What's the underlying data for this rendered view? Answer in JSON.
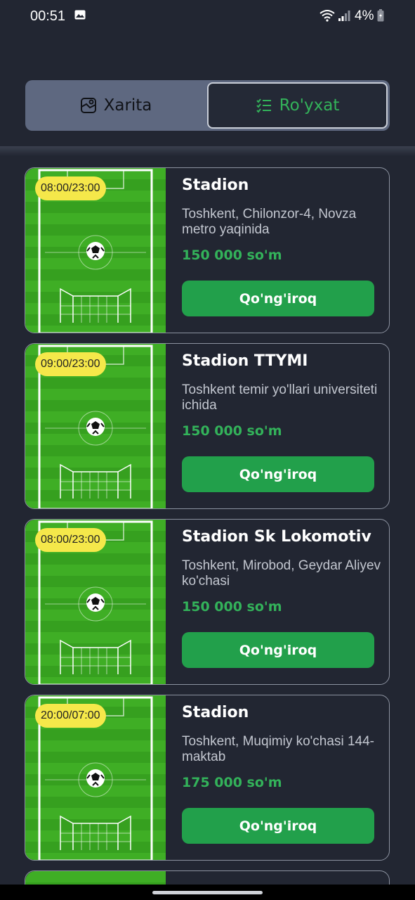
{
  "status_bar": {
    "time": "00:51",
    "battery": "4%",
    "icons": [
      "gallery-icon",
      "wifi-icon",
      "signal-icon",
      "battery-icon"
    ]
  },
  "segmented_control": {
    "map_label": "Xarita",
    "list_label": "Ro'yxat",
    "selected": "list",
    "accent_color": "#33b25a"
  },
  "stadiums": [
    {
      "hours": "08:00/23:00",
      "name": "Stadion",
      "address": "Toshkent, Chilonzor-4, Novza metro yaqinida",
      "price": "150 000 so'm",
      "call_label": "Qo'ng'iroq"
    },
    {
      "hours": "09:00/23:00",
      "name": "Stadion TTYMI",
      "address": "Toshkent temir yo'llari universiteti ichida",
      "price": "150 000 so'm",
      "call_label": "Qo'ng'iroq"
    },
    {
      "hours": "08:00/23:00",
      "name": "Stadion Sk Lokomotiv",
      "address": "Toshkent, Mirobod, Geydar Aliyev ko'chasi",
      "price": "150 000 so'm",
      "call_label": "Qo'ng'iroq"
    },
    {
      "hours": "20:00/07:00",
      "name": "Stadion",
      "address": "Toshkent, Muqimiy ko'chasi 144-maktab",
      "price": "175 000 so'm",
      "call_label": "Qo'ng'iroq"
    }
  ],
  "colors": {
    "background": "#222632",
    "badge": "#f5e84a",
    "button": "#22a04b",
    "price": "#33b25a"
  }
}
